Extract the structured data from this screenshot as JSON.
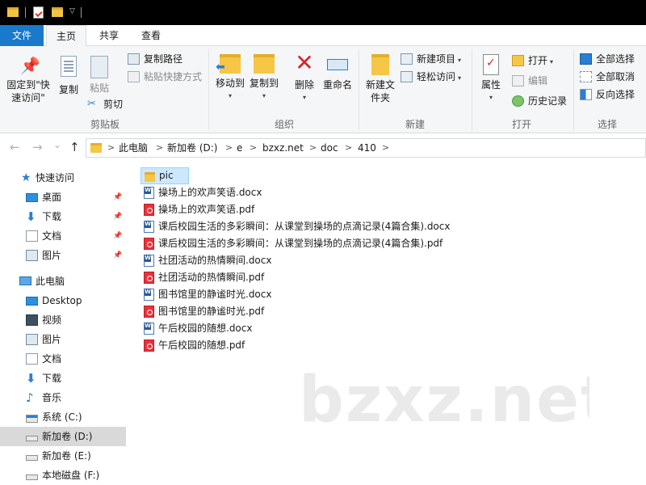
{
  "ribbon_tabs": {
    "file": "文件",
    "home": "主页",
    "share": "共享",
    "view": "查看"
  },
  "ribbon": {
    "clipboard": {
      "group_label": "剪贴板",
      "pin_quick_access": "固定到\"快速访问\"",
      "copy": "复制",
      "paste": "粘贴",
      "copy_path": "复制路径",
      "paste_shortcut": "粘贴快捷方式",
      "cut": "剪切"
    },
    "organize": {
      "group_label": "组织",
      "move_to": "移动到",
      "copy_to": "复制到",
      "delete": "删除",
      "rename": "重命名"
    },
    "new": {
      "group_label": "新建",
      "new_folder": "新建文件夹",
      "new_item": "新建项目",
      "easy_access": "轻松访问"
    },
    "open": {
      "group_label": "打开",
      "properties": "属性",
      "open": "打开",
      "edit": "编辑",
      "history": "历史记录"
    },
    "select": {
      "group_label": "选择",
      "select_all": "全部选择",
      "select_none": "全部取消",
      "invert": "反向选择"
    }
  },
  "nav": {
    "back": "←",
    "forward": "→",
    "recent": "⌄",
    "up": "↑",
    "breadcrumb": [
      "此电脑",
      "新加卷 (D:)",
      "e",
      "bzxz.net",
      "doc",
      "410"
    ],
    "chevron": ">"
  },
  "sidebar": {
    "quick_access": "快速访问",
    "quick_items": [
      {
        "label": "桌面",
        "icon": "desktop-icon"
      },
      {
        "label": "下载",
        "icon": "download-icon"
      },
      {
        "label": "文档",
        "icon": "documents-icon"
      },
      {
        "label": "图片",
        "icon": "pictures-icon"
      }
    ],
    "this_pc": "此电脑",
    "pc_items": [
      {
        "label": "Desktop",
        "icon": "desktop-icon"
      },
      {
        "label": "视频",
        "icon": "videos-icon"
      },
      {
        "label": "图片",
        "icon": "pictures-icon"
      },
      {
        "label": "文档",
        "icon": "documents-icon"
      },
      {
        "label": "下载",
        "icon": "download-icon"
      },
      {
        "label": "音乐",
        "icon": "music-icon"
      },
      {
        "label": "系统 (C:)",
        "icon": "system-drive-icon"
      },
      {
        "label": "新加卷 (D:)",
        "icon": "drive-icon"
      },
      {
        "label": "新加卷 (E:)",
        "icon": "drive-icon"
      },
      {
        "label": "本地磁盘 (F:)",
        "icon": "drive-icon"
      }
    ]
  },
  "files": [
    {
      "name": "pic",
      "type": "folder"
    },
    {
      "name": "操场上的欢声笑语.docx",
      "type": "word"
    },
    {
      "name": "操场上的欢声笑语.pdf",
      "type": "pdf"
    },
    {
      "name": "课后校园生活的多彩瞬间：从课堂到操场的点滴记录(4篇合集).docx",
      "type": "word"
    },
    {
      "name": "课后校园生活的多彩瞬间：从课堂到操场的点滴记录(4篇合集).pdf",
      "type": "pdf"
    },
    {
      "name": "社团活动的热情瞬间.docx",
      "type": "word"
    },
    {
      "name": "社团活动的热情瞬间.pdf",
      "type": "pdf"
    },
    {
      "name": "图书馆里的静谧时光.docx",
      "type": "word"
    },
    {
      "name": "图书馆里的静谧时光.pdf",
      "type": "pdf"
    },
    {
      "name": "午后校园的随想.docx",
      "type": "word"
    },
    {
      "name": "午后校园的随想.pdf",
      "type": "pdf"
    }
  ],
  "watermark": "bzxz.net",
  "colors": {
    "accent": "#1979ca",
    "selection": "#cce8ff",
    "folder": "#f6c646",
    "pdf": "#e8323c",
    "word": "#2b5797"
  }
}
